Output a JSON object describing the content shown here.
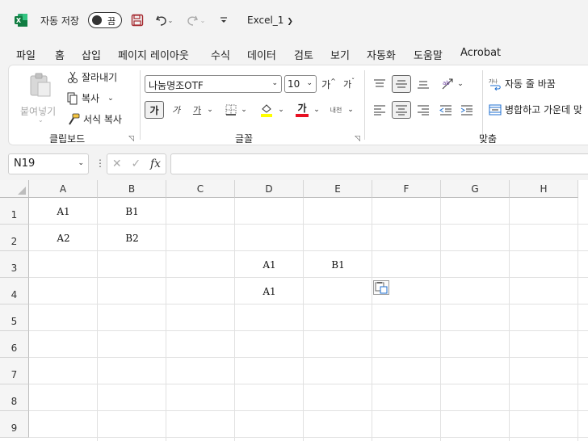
{
  "titlebar": {
    "app_icon": "excel-logo-icon",
    "autosave_label": "자동 저장",
    "autosave_state": "끔",
    "doc_title": "Excel_1"
  },
  "menu": {
    "items": [
      "파일",
      "홈",
      "삽입",
      "페이지 레이아웃",
      "수식",
      "데이터",
      "검토",
      "보기",
      "자동화",
      "도움말",
      "Acrobat"
    ],
    "active": "홈"
  },
  "ribbon": {
    "clipboard": {
      "paste": "붙여넣기",
      "cut": "잘라내기",
      "copy": "복사",
      "format_painter": "서식 복사",
      "label": "클립보드"
    },
    "font": {
      "font_name": "나눔명조OTF",
      "font_size": "10",
      "grow": "가",
      "shrink": "가",
      "bold": "가",
      "italic": "가",
      "underline": "가",
      "font_color_glyph": "가",
      "phonetic": "내천",
      "label": "글꼴"
    },
    "alignment": {
      "wrap_text": "자동 줄 바꿈",
      "merge_center": "병합하고 가운데 맞",
      "label": "맞춤"
    }
  },
  "formula_bar": {
    "name_box": "N19",
    "fx": "fx",
    "formula": ""
  },
  "sheet": {
    "columns": [
      "A",
      "B",
      "C",
      "D",
      "E",
      "F",
      "G",
      "H"
    ],
    "rows": [
      "1",
      "2",
      "3",
      "4",
      "5",
      "6",
      "7",
      "8",
      "9"
    ],
    "cells": {
      "A1": "A1",
      "B1": "B1",
      "A2": "A2",
      "B2": "B2",
      "D3": "A1",
      "E3": "B1",
      "D4": "A1"
    }
  },
  "colors": {
    "accent": "#217346",
    "highlight_yellow": "#ffff00",
    "font_red": "#e81123"
  }
}
